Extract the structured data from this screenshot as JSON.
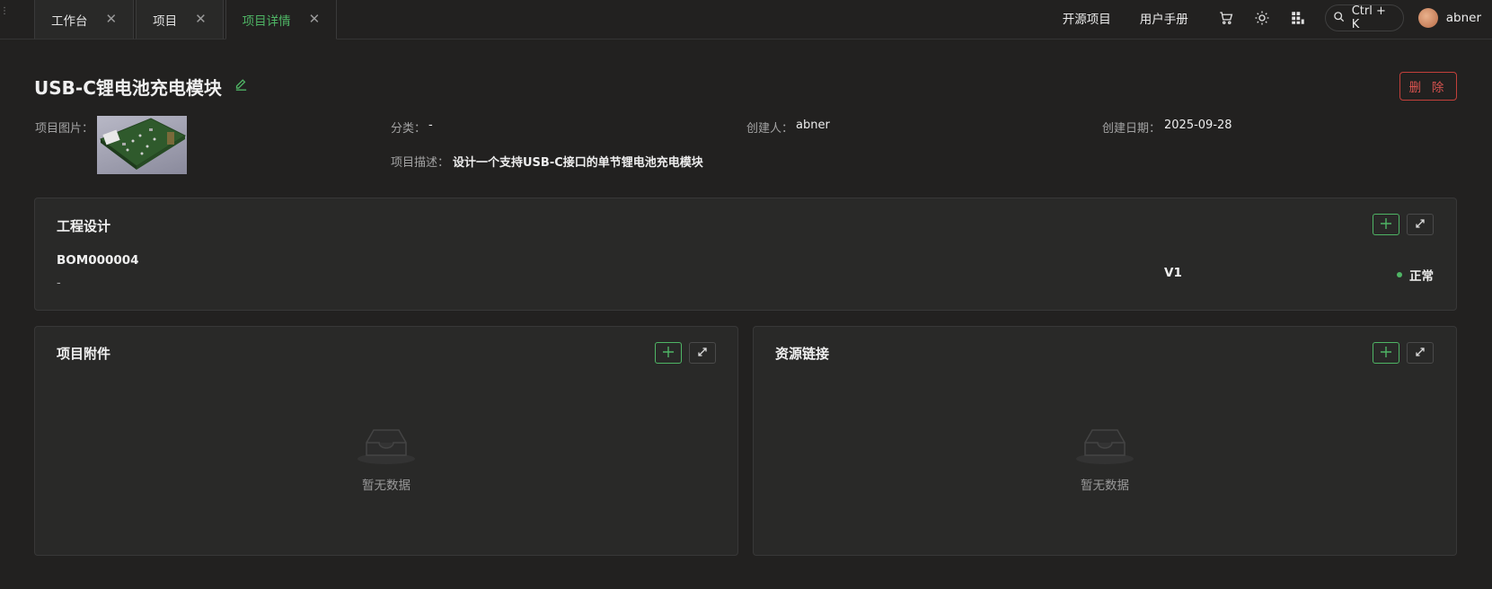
{
  "tabs": [
    {
      "label": "工作台",
      "active": false
    },
    {
      "label": "项目",
      "active": false
    },
    {
      "label": "项目详情",
      "active": true
    }
  ],
  "topbar": {
    "link_open_source": "开源项目",
    "link_manual": "用户手册",
    "search_shortcut": "Ctrl + K",
    "username": "abner",
    "icons": [
      "cart-icon",
      "sun-icon",
      "apps-icon",
      "search-icon"
    ]
  },
  "project": {
    "title": "USB-C锂电池充电模块",
    "delete_label": "删 除",
    "image_label": "项目图片：",
    "category_label": "分类：",
    "category_value": "-",
    "creator_label": "创建人：",
    "creator_value": "abner",
    "created_date_label": "创建日期：",
    "created_date_value": "2025-09-28",
    "description_label": "项目描述：",
    "description_value": "设计一个支持USB-C接口的单节锂电池充电模块"
  },
  "engineering": {
    "title": "工程设计",
    "items": [
      {
        "code": "BOM000004",
        "desc": "-",
        "version": "V1",
        "status": "正常"
      }
    ]
  },
  "attachments": {
    "title": "项目附件",
    "empty_text": "暂无数据"
  },
  "resources": {
    "title": "资源链接",
    "empty_text": "暂无数据"
  },
  "colors": {
    "accent": "#4fb565",
    "danger": "#d9534f",
    "background": "#222120",
    "card": "#292928"
  }
}
